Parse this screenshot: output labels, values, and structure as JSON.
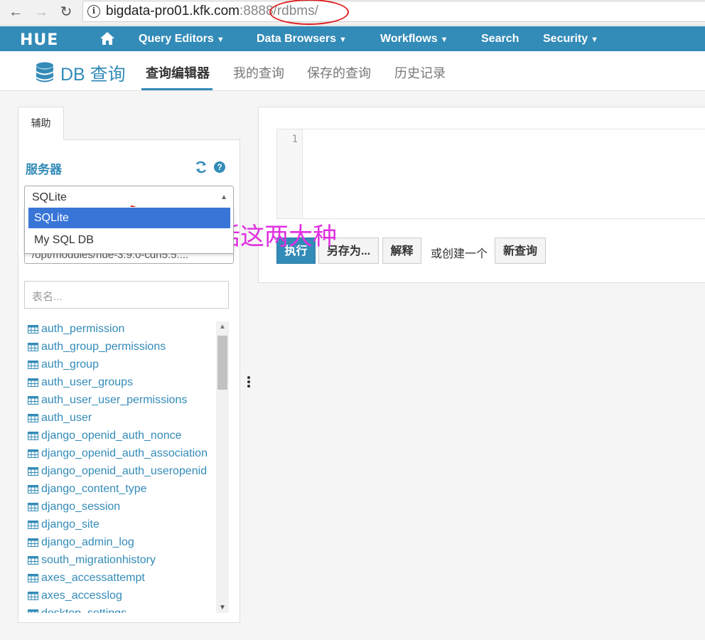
{
  "browser": {
    "back": "←",
    "forward": "→",
    "reload": "↻",
    "url_host": "bigdata-pro01.kfk.com",
    "url_port_path": ":8888/rdbms/"
  },
  "hue_nav": {
    "logo": "HUE",
    "items": [
      {
        "label": "Query Editors",
        "caret": "▼"
      },
      {
        "label": "Data Browsers",
        "caret": "▼"
      },
      {
        "label": "Workflows",
        "caret": "▼"
      },
      {
        "label": "Search"
      },
      {
        "label": "Security",
        "caret": "▼"
      }
    ],
    "accent": "#338bb8"
  },
  "subheader": {
    "title": "DB 查询",
    "tabs": [
      {
        "label": "查询编辑器",
        "active": true
      },
      {
        "label": "我的查询"
      },
      {
        "label": "保存的查询"
      },
      {
        "label": "历史记录"
      }
    ]
  },
  "assist": {
    "tab_label": "辅助",
    "server_label": "服务器",
    "help_glyph": "?",
    "selected_server": "SQLite",
    "dropdown_options": [
      "SQLite",
      "My SQL DB"
    ],
    "database_value": "/opt/modules/hue-3.9.0-cdh5.5....",
    "table_search_placeholder": "表名...",
    "tables": [
      "auth_permission",
      "auth_group_permissions",
      "auth_group",
      "auth_user_groups",
      "auth_user_user_permissions",
      "auth_user",
      "django_openid_auth_nonce",
      "django_openid_auth_association",
      "django_openid_auth_useropenid",
      "django_content_type",
      "django_session",
      "django_site",
      "django_admin_log",
      "south_migrationhistory",
      "axes_accessattempt",
      "axes_accesslog",
      "desktop_settings"
    ]
  },
  "editor": {
    "line_number": "1",
    "buttons": {
      "execute": "执行",
      "save_as": "另存为...",
      "explain": "解释",
      "or_create": "或创建一个",
      "new_query": "新查询"
    }
  },
  "annotation": {
    "text": "包括这两大种",
    "color": "#e030e0"
  }
}
